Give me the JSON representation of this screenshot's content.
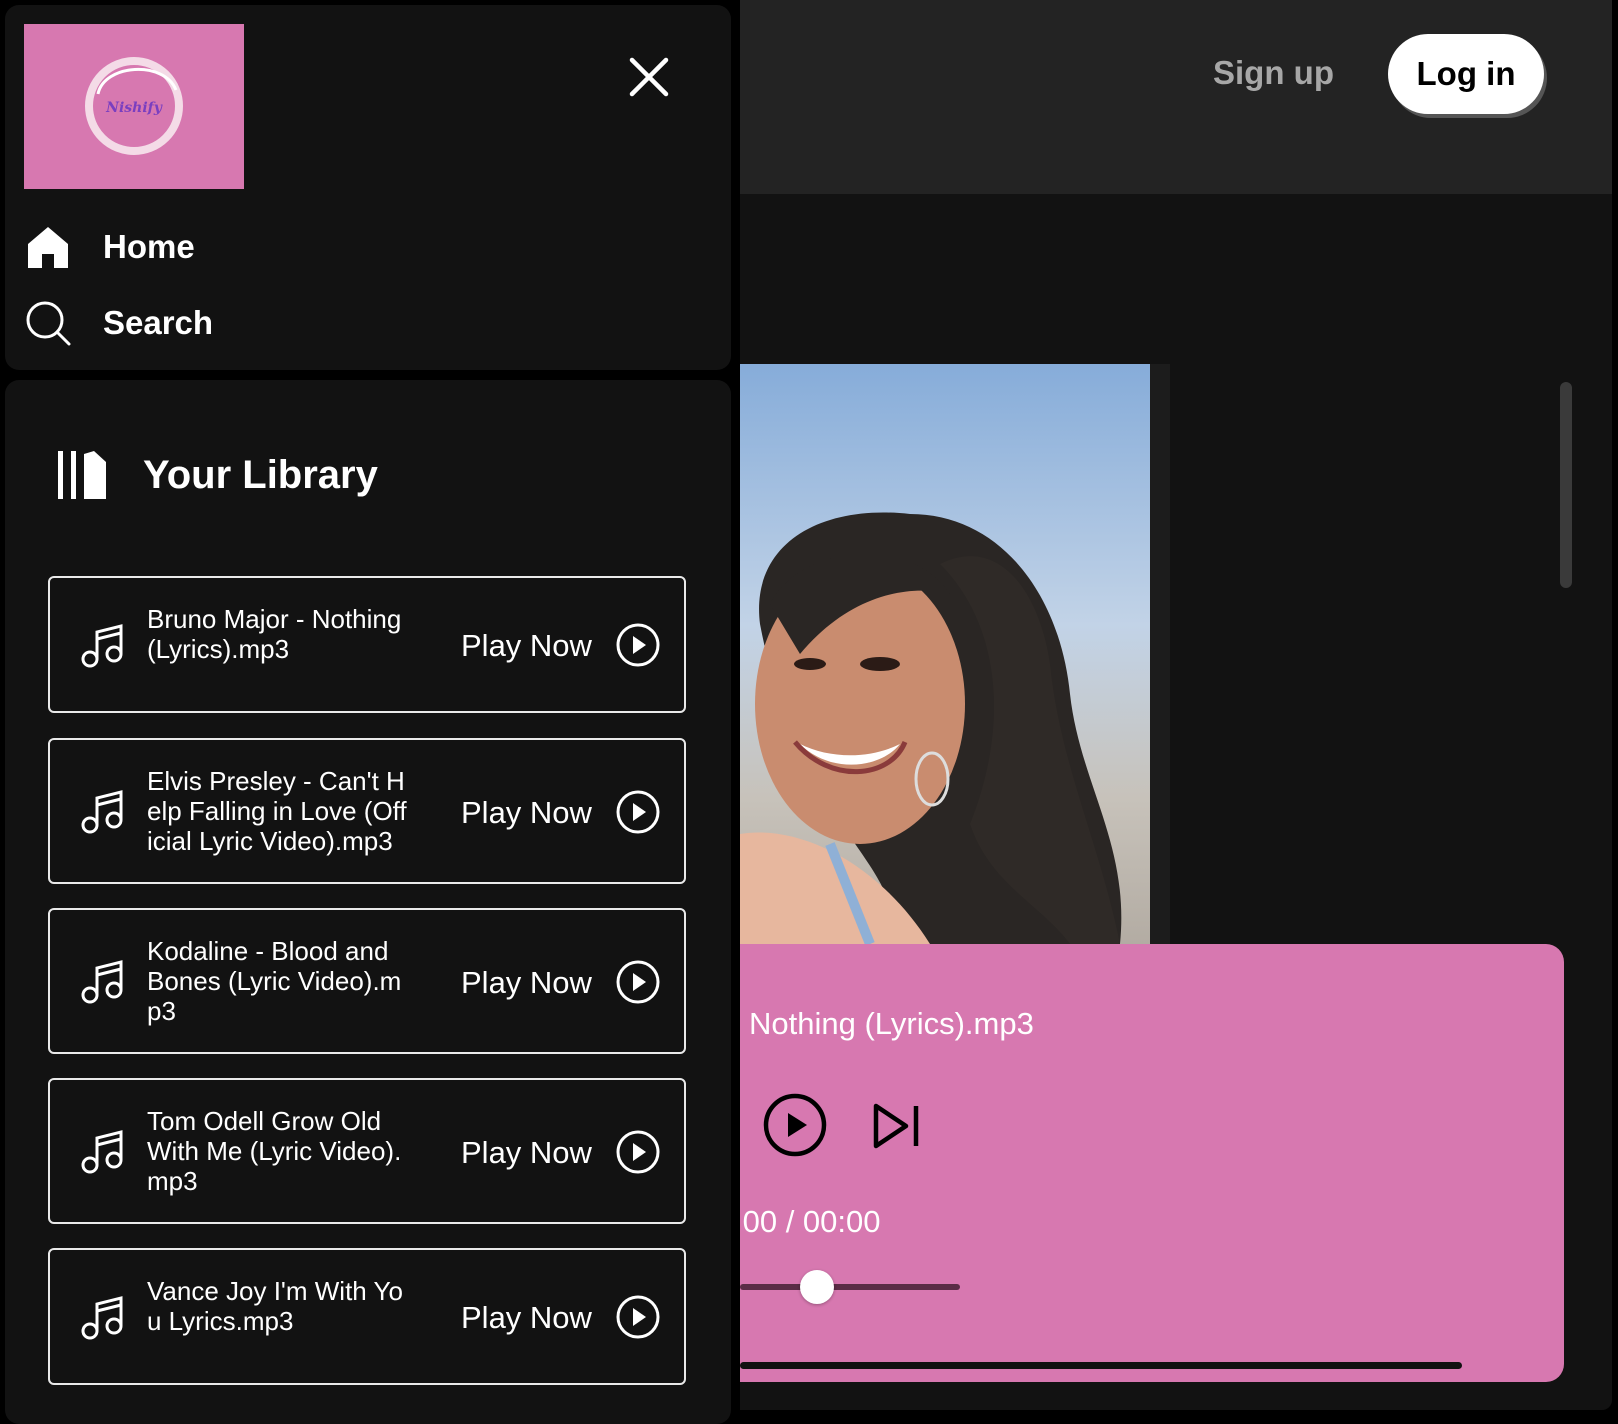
{
  "header": {
    "signup_label": "Sign up",
    "login_label": "Log in"
  },
  "sidebar": {
    "logo_text": "Nishify",
    "nav": [
      {
        "label": "Home",
        "icon": "home-icon"
      },
      {
        "label": "Search",
        "icon": "search-icon"
      }
    ],
    "library_title": "Your Library"
  },
  "library": {
    "tracks": [
      {
        "name": "Bruno Major - Nothing (Lyrics).mp3",
        "play_label": "Play Now"
      },
      {
        "name": "Elvis Presley - Can't Help Falling in Love (Official Lyric Video).mp3",
        "play_label": "Play Now"
      },
      {
        "name": "Kodaline - Blood and Bones (Lyric Video).mp3",
        "play_label": "Play Now"
      },
      {
        "name": "Tom Odell Grow Old With Me (Lyric Video).mp3",
        "play_label": "Play Now"
      },
      {
        "name": "Vance Joy I'm With You Lyrics.mp3",
        "play_label": "Play Now"
      }
    ]
  },
  "player": {
    "now_playing": "Nothing (Lyrics).mp3",
    "time": ":00 / 00:00",
    "volume_level": 0.35,
    "progress": 0
  },
  "colors": {
    "accent": "#d778b0",
    "panel": "#121212",
    "topbar": "#232323"
  }
}
